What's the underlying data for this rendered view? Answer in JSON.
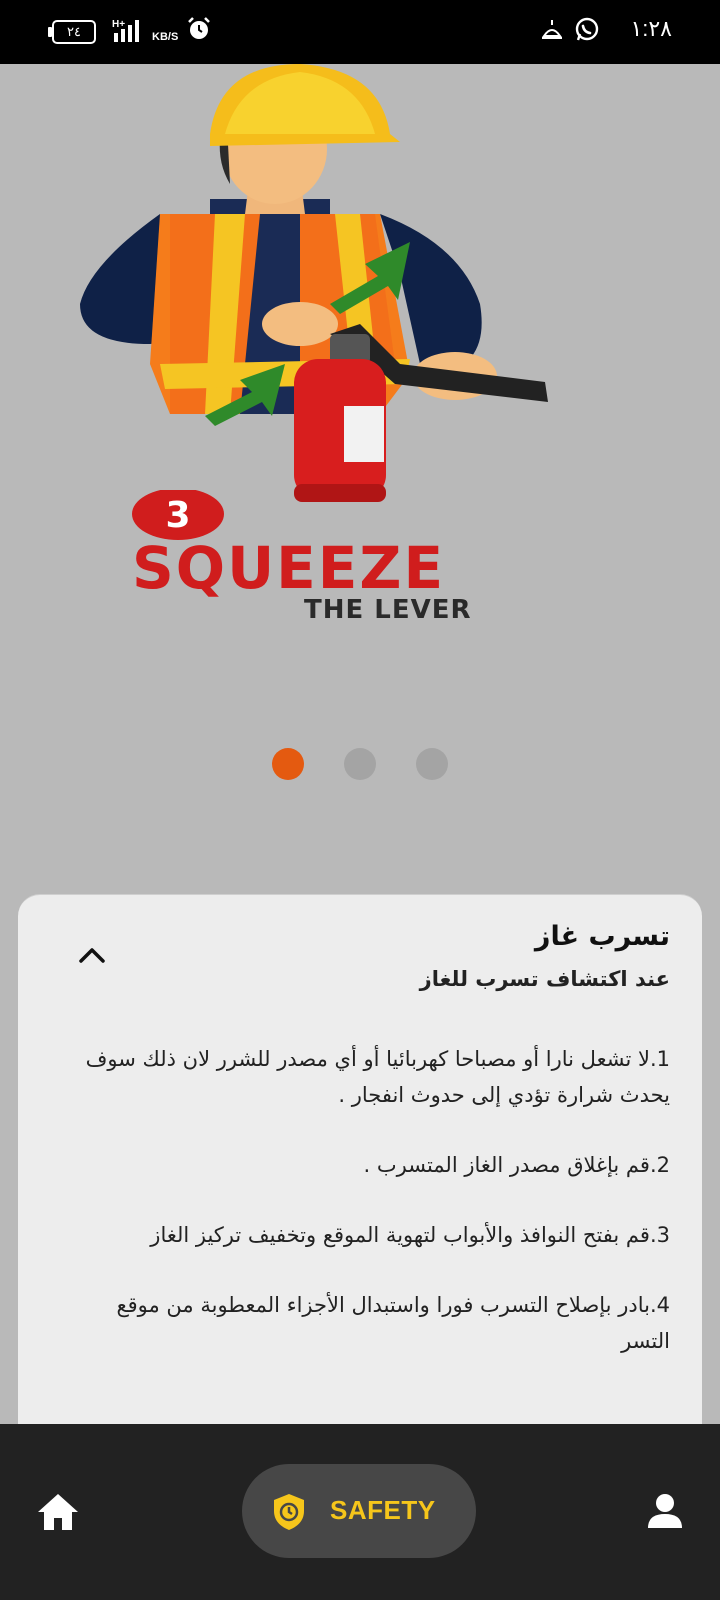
{
  "status_bar": {
    "time": "١:٢٨",
    "battery": "٢٤",
    "network_type": "H+",
    "net_speed_unit": "KB/S"
  },
  "hero": {
    "step_number": "3",
    "headline": "SQUEEZE",
    "subline": "THE LEVER",
    "colors": {
      "headline": "#d01d1d",
      "subline": "#2a2a2a"
    }
  },
  "carousel": {
    "count": 3,
    "active_index": 0,
    "active_color": "#e45a10",
    "inactive_color": "#a4a4a4"
  },
  "card": {
    "title": "تسرب غاز",
    "subtitle": "عند اكتشاف تسرب للغاز",
    "steps": [
      "1.لا تشعل نارا أو مصباحا كهربائيا أو أي مصدر للشرر لان ذلك سوف يحدث شرارة تؤدي إلى حدوث انفجار .",
      "2.قم بإغلاق مصدر الغاز المتسرب .",
      "3.قم بفتح النوافذ والأبواب لتهوية الموقع وتخفيف تركيز الغاز",
      "4.بادر بإصلاح التسرب فورا واستبدال الأجزاء المعطوبة من موقع التسر"
    ],
    "icon": "chevron-up-icon"
  },
  "bottom_nav": {
    "home_icon": "home-icon",
    "active_label": "SAFETY",
    "active_icon": "shield-clock-icon",
    "profile_icon": "person-icon",
    "accent_color": "#f6c61b"
  }
}
